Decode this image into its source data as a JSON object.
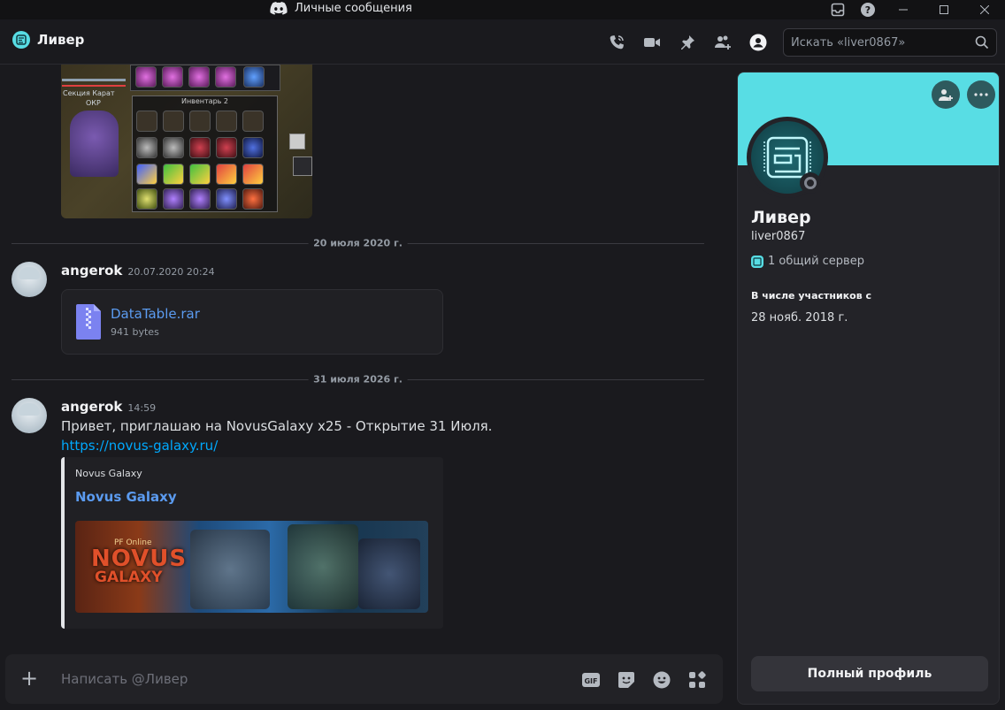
{
  "window": {
    "title": "Личные сообщения"
  },
  "header": {
    "title": "Ливер",
    "search_placeholder": "Искать «liver0867»"
  },
  "game_screenshot": {
    "overlay_label": "Секция Карат",
    "overlay_label2": "ОКР",
    "inventory_title": "Инвентарь 2"
  },
  "dividers": [
    "20 июля 2020 г.",
    "31 июля 2026 г."
  ],
  "messages": [
    {
      "author": "angerok",
      "timestamp": "20.07.2020 20:24",
      "attachment": {
        "name": "DataTable.rar",
        "size": "941 bytes"
      }
    },
    {
      "author": "angerok",
      "timestamp": "14:59",
      "text": "Привет, приглашаю на NovusGalaxy x25 - Открытие 31 Июля.",
      "link": "https://novus-galaxy.ru/",
      "embed": {
        "provider": "Novus Galaxy",
        "title": "Novus Galaxy",
        "banner_small": "PF Online",
        "banner_big": "NOVUS",
        "banner_sub": "GALAXY"
      }
    }
  ],
  "composer": {
    "placeholder": "Написать @Ливер",
    "gif_label": "GIF"
  },
  "profile": {
    "name": "Ливер",
    "username": "liver0867",
    "mutual": "1 общий сервер",
    "member_since_label": "В числе участников с",
    "member_since": "28 нояб. 2018 г.",
    "full_profile_button": "Полный профиль",
    "banner_color": "#58dde4"
  },
  "colors": {
    "link": "#00a8fc",
    "accent_blue": "#5b9bf0",
    "background": "#1a1a1e"
  }
}
